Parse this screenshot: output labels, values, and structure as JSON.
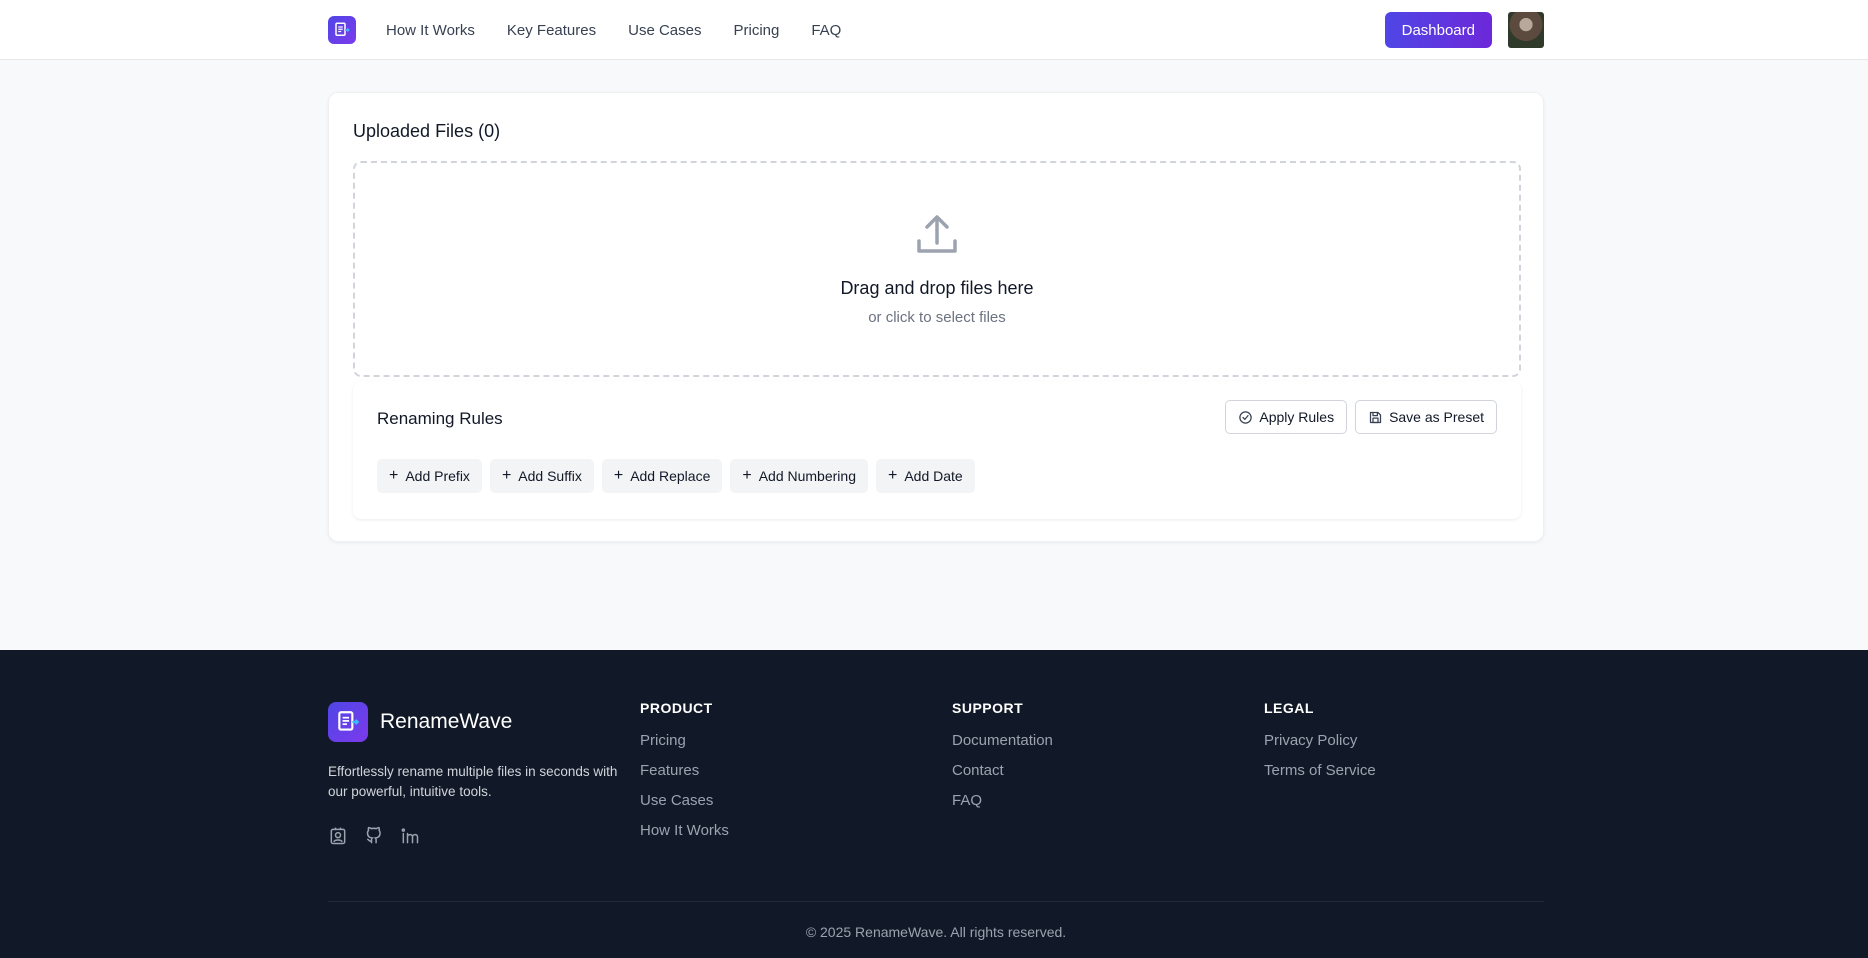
{
  "header": {
    "nav": [
      "How It Works",
      "Key Features",
      "Use Cases",
      "Pricing",
      "FAQ"
    ],
    "dashboard_label": "Dashboard"
  },
  "upload": {
    "title": "Uploaded Files (0)",
    "drop_main": "Drag and drop files here",
    "drop_sub": "or click to select files"
  },
  "rules": {
    "title": "Renaming Rules",
    "apply_label": "Apply Rules",
    "preset_label": "Save as Preset",
    "add_buttons": [
      "Add Prefix",
      "Add Suffix",
      "Add Replace",
      "Add Numbering",
      "Add Date"
    ]
  },
  "footer": {
    "brand": "RenameWave",
    "description": "Effortlessly rename multiple files in seconds with our powerful, intuitive tools.",
    "socials": [
      "portfolio-icon",
      "github-icon",
      "linkedin-icon"
    ],
    "columns": [
      {
        "title": "PRODUCT",
        "links": [
          "Pricing",
          "Features",
          "Use Cases",
          "How It Works"
        ]
      },
      {
        "title": "SUPPORT",
        "links": [
          "Documentation",
          "Contact",
          "FAQ"
        ]
      },
      {
        "title": "LEGAL",
        "links": [
          "Privacy Policy",
          "Terms of Service"
        ]
      }
    ],
    "copyright": "© 2025 RenameWave. All rights reserved."
  },
  "colors": {
    "accent": "#4f46e5",
    "footer_bg": "#111827",
    "page_bg": "#f8f9fb"
  }
}
